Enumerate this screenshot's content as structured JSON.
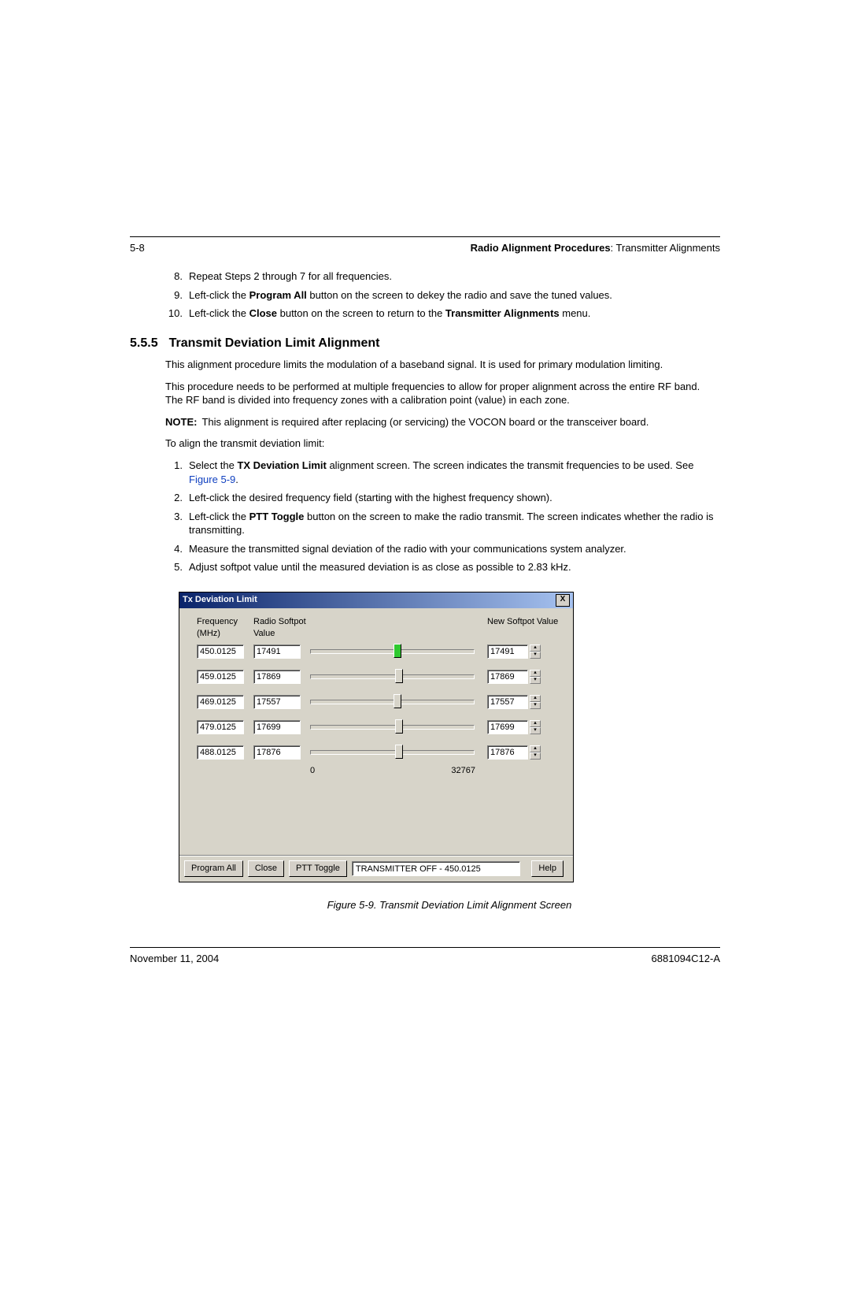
{
  "header": {
    "pagenum": "5-8",
    "title_bold": "Radio Alignment Procedures",
    "title_rest": ": Transmitter Alignments"
  },
  "preceding_list": [
    {
      "num": "8.",
      "text_a": "Repeat Steps 2 through 7 for all frequencies."
    },
    {
      "num": "9.",
      "text_a": "Left-click the ",
      "bold1": "Program All",
      "text_b": " button on the screen to dekey the radio and save the tuned values."
    },
    {
      "num": "10.",
      "text_a": "Left-click the ",
      "bold1": "Close",
      "text_b": " button on the screen to return to the ",
      "bold2": "Transmitter Alignments",
      "text_c": " menu."
    }
  ],
  "section": {
    "num": "5.5.5",
    "title": "Transmit Deviation Limit Alignment"
  },
  "para1": "This alignment procedure limits the modulation of a baseband signal. It is used for primary modulation limiting.",
  "para2": "This procedure needs to be performed at multiple frequencies to allow for proper alignment across the entire RF band. The RF band is divided into frequency zones with a calibration point (value) in each zone.",
  "note": {
    "label": "NOTE:",
    "text": "This alignment is required after replacing (or servicing) the VOCON board or the transceiver board."
  },
  "para3": "To align the transmit deviation limit:",
  "steps": [
    {
      "num": "1.",
      "a": "Select the ",
      "b1": "TX Deviation Limit",
      "b": " alignment screen. The screen indicates the transmit frequencies to be used. See ",
      "figref": "Figure 5-9",
      "c": "."
    },
    {
      "num": "2.",
      "a": "Left-click the desired frequency field (starting with the highest frequency shown)."
    },
    {
      "num": "3.",
      "a": "Left-click the ",
      "b1": "PTT Toggle",
      "b": " button on the screen to make the radio transmit. The screen indicates whether the radio is transmitting."
    },
    {
      "num": "4.",
      "a": "Measure the transmitted signal deviation of the radio with your communications system analyzer."
    },
    {
      "num": "5.",
      "a": "Adjust softpot value until the measured deviation is as close as possible to 2.83 kHz."
    }
  ],
  "gui": {
    "title": "Tx Deviation Limit",
    "close_x": "X",
    "h_freq": "Frequency (MHz)",
    "h_radio": "Radio Softpot Value",
    "h_new": "New Softpot Value",
    "rows": [
      {
        "freq": "450.0125",
        "radio": "17491",
        "new": "17491",
        "thumb_pct": 53,
        "active": true
      },
      {
        "freq": "459.0125",
        "radio": "17869",
        "new": "17869",
        "thumb_pct": 54,
        "active": false
      },
      {
        "freq": "469.0125",
        "radio": "17557",
        "new": "17557",
        "thumb_pct": 53,
        "active": false
      },
      {
        "freq": "479.0125",
        "radio": "17699",
        "new": "17699",
        "thumb_pct": 54,
        "active": false
      },
      {
        "freq": "488.0125",
        "radio": "17876",
        "new": "17876",
        "thumb_pct": 54,
        "active": false
      }
    ],
    "scale_min": "0",
    "scale_max": "32767",
    "btn_program_all": "Program All",
    "btn_close": "Close",
    "btn_ptt": "PTT Toggle",
    "status": "TRANSMITTER OFF - 450.0125",
    "btn_help": "Help"
  },
  "figcaption": "Figure 5-9.  Transmit Deviation Limit Alignment Screen",
  "footer": {
    "date": "November 11, 2004",
    "docnum": "6881094C12-A"
  }
}
